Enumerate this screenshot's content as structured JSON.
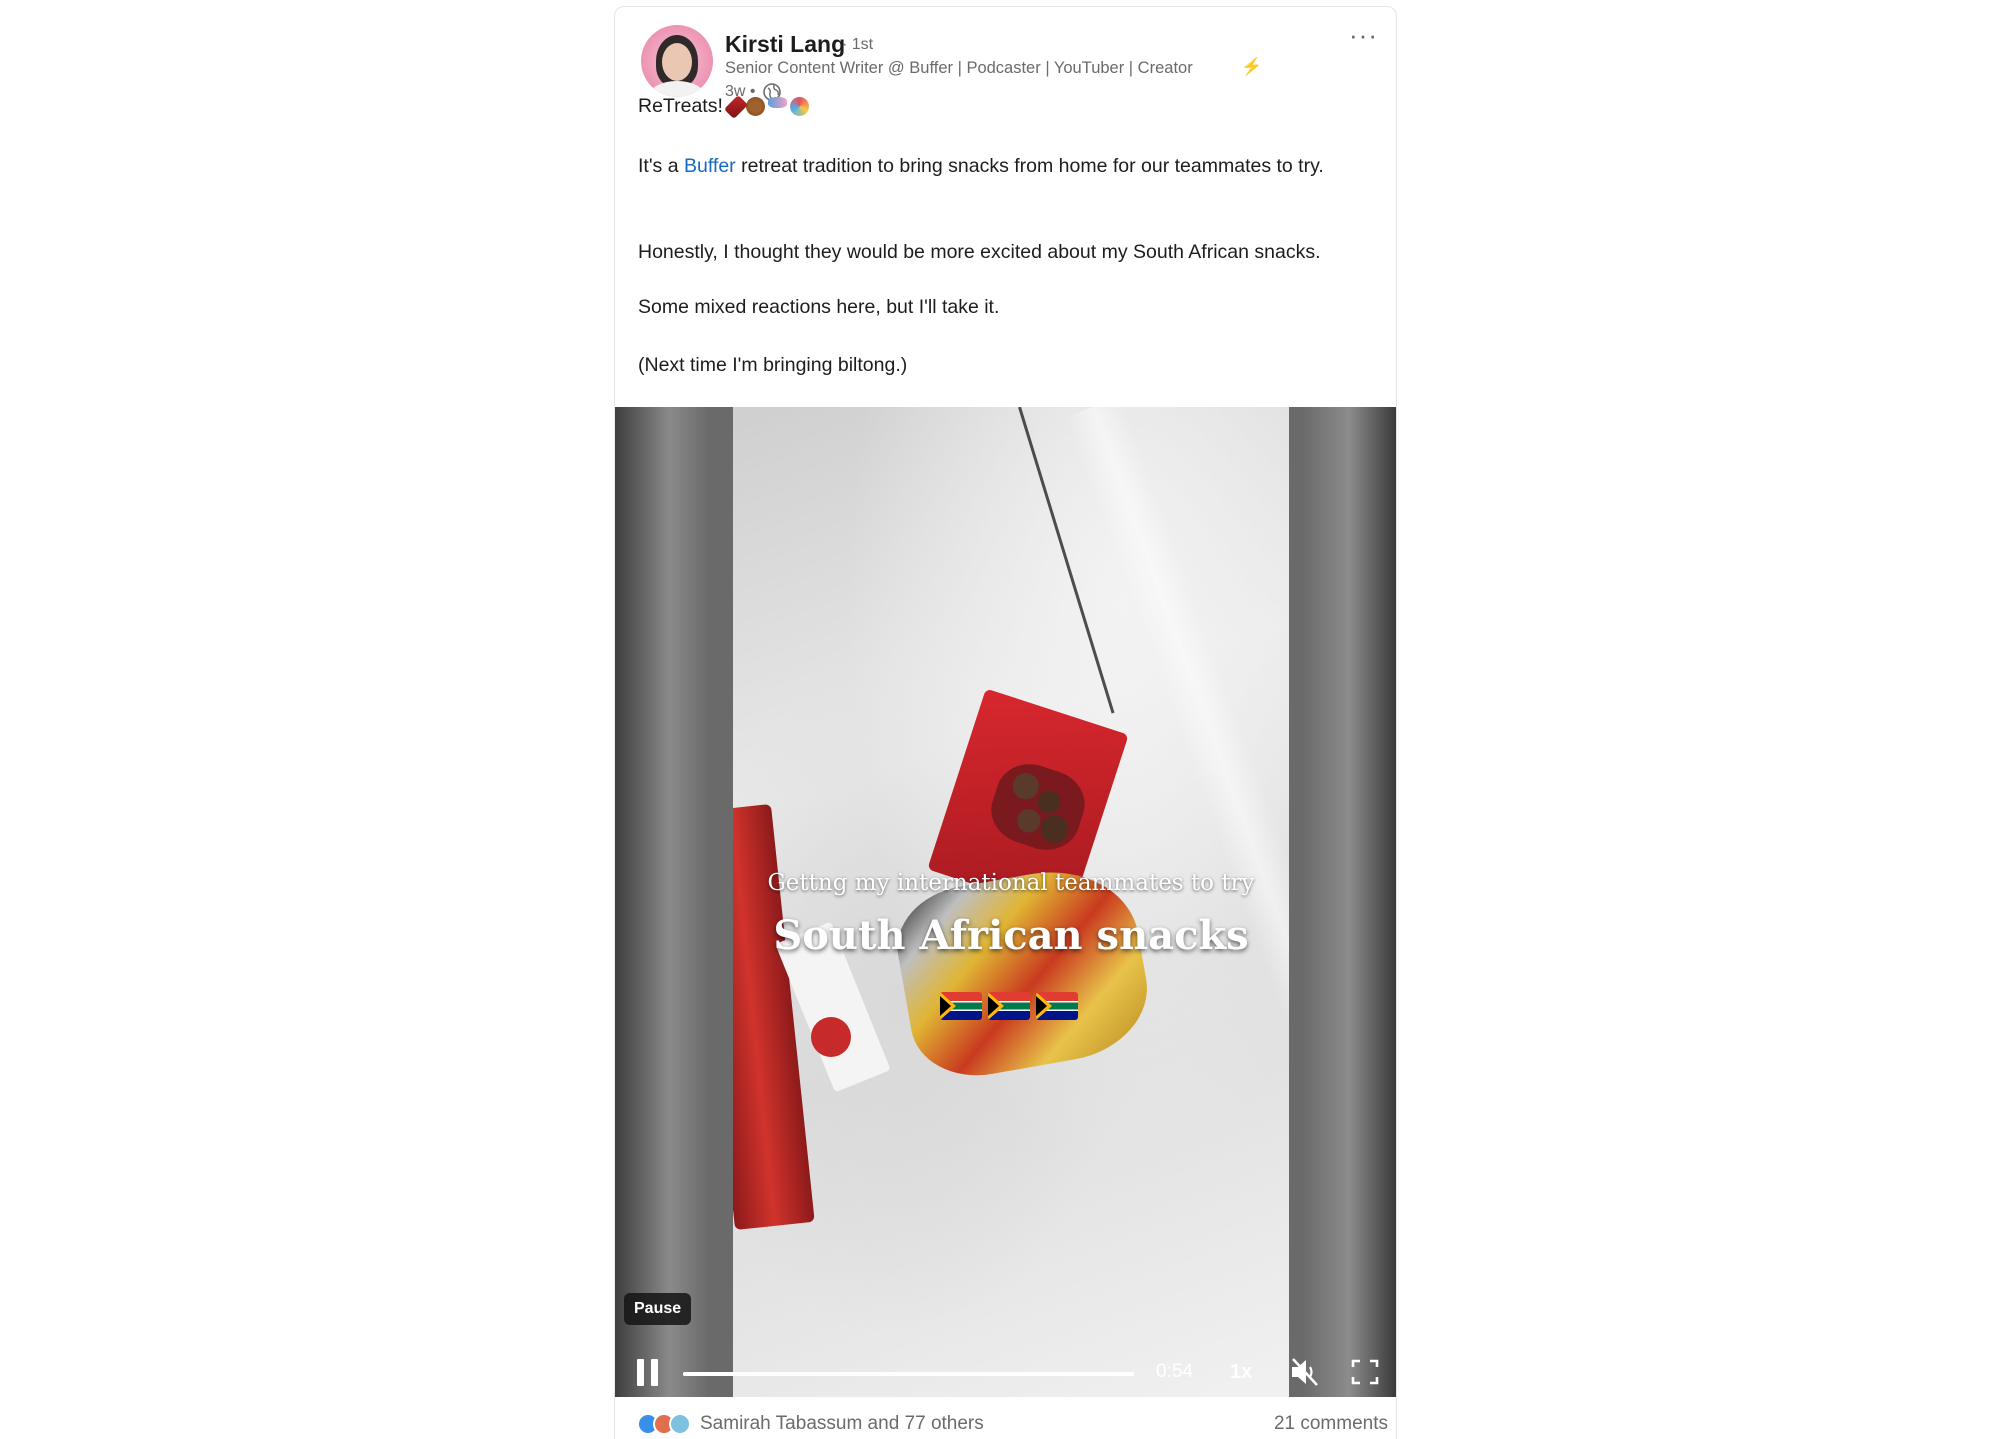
{
  "post": {
    "author": {
      "name": "Kirsti Lang",
      "degree": "· 1st",
      "headline": "Senior Content Writer @ Buffer | Podcaster | YouTuber | Creator",
      "time": "3w •"
    },
    "more_label": "···",
    "text": {
      "line1": "ReTreats!",
      "p2_before": "It's a ",
      "p2_link": "Buffer",
      "p2_after": " retreat tradition to bring snacks from home for our teammates to try.",
      "p3": "Honestly, I thought they would be more excited about my South African snacks.",
      "p4": "Some mixed reactions here, but I'll take it.",
      "p5": "(Next time I'm bringing biltong.)"
    }
  },
  "video": {
    "overlay_subtitle": "Gettng my international teammates to try",
    "overlay_title": "South African snacks",
    "tooltip": "Pause",
    "time_remaining": "0:54",
    "speed": "1x",
    "progress": 1.0,
    "muted": true
  },
  "footer": {
    "reactors": "Samirah Tabassum and 77 others",
    "comments": "21 comments"
  },
  "colors": {
    "link": "#1769c2",
    "muted_text": "#6b6b6b",
    "avatar_bg": "#ee9bb8"
  }
}
